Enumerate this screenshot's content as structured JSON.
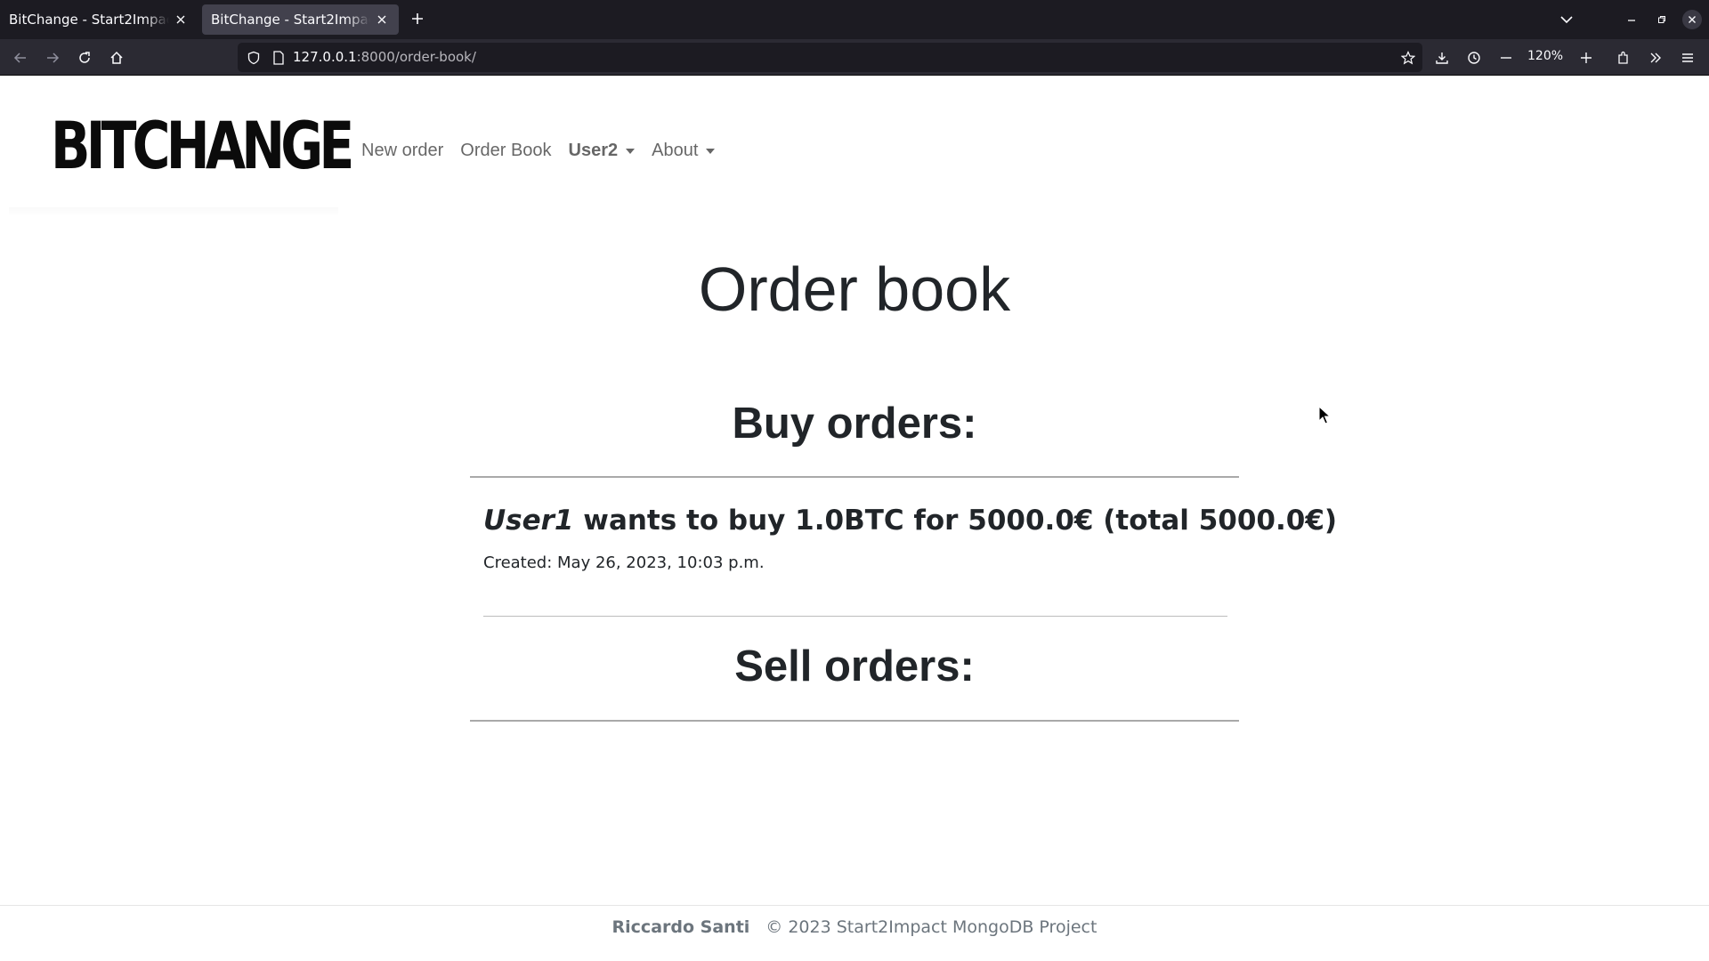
{
  "browser": {
    "tabs": [
      {
        "title": "BitChange - Start2Impact MongoDB Project",
        "active": false
      },
      {
        "title": "BitChange - Start2Impact MongoDB Project",
        "active": true
      }
    ],
    "url": {
      "host": "127.0.0.1",
      "path": ":8000/order-book/"
    },
    "zoom": "120%",
    "icons": [
      "back-icon",
      "forward-icon",
      "reload-icon",
      "home-icon",
      "shield-icon",
      "page-icon",
      "star-icon",
      "download-icon",
      "history-icon",
      "zoom-out-icon",
      "zoom-in-icon",
      "extensions-icon",
      "overflow-icon",
      "menu-icon"
    ]
  },
  "site": {
    "brand": "BITCHANGE",
    "nav": {
      "new_order": "New order",
      "order_book": "Order Book",
      "user": "User2",
      "about": "About"
    }
  },
  "main": {
    "title": "Order book",
    "buy_heading": "Buy orders:",
    "sell_heading": "Sell orders:",
    "buy_orders": [
      {
        "user": "User1",
        "text": " wants to buy 1.0BTC for 5000.0€ (total 5000.0€)",
        "created": "Created: May 26, 2023, 10:03 p.m."
      }
    ]
  },
  "footer": {
    "author": "Riccardo Santi",
    "copyright": "© 2023 Start2Impact MongoDB Project"
  }
}
